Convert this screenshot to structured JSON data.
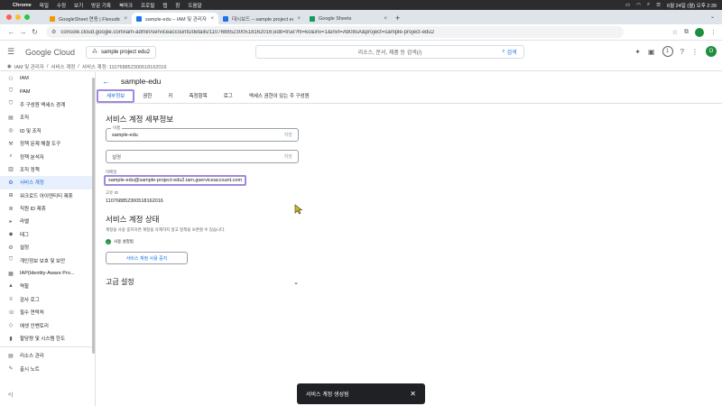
{
  "menubar": {
    "app": "Chrome",
    "items": [
      "파일",
      "수정",
      "보기",
      "방문 기록",
      "북마크",
      "프로필",
      "탭",
      "창",
      "도움말"
    ],
    "datetime": "6월 24일 (월) 오후 2:39"
  },
  "browser": {
    "tabs": [
      {
        "title": "GoogleSheet 연동 | Flexudio",
        "color": "#f29900"
      },
      {
        "title": "sample-edu – IAM 및 관리자 –",
        "color": "#1a73e8"
      },
      {
        "title": "대시보드 – sample project edu",
        "color": "#1a73e8"
      },
      {
        "title": "Google Sheets",
        "color": "#0f9d58"
      }
    ],
    "new_tab": "+",
    "url": "console.cloud.google.com/iam-admin/serviceaccounts/details/110768852300518162016;edit=true?hl=ko&inv=1&invt=Ab08sA&project=sample-project-edu2",
    "account_initial": ""
  },
  "header": {
    "logo": "Google Cloud",
    "project": "sample project edu2",
    "search_placeholder": "리소스, 문서, 제품 등 검색(/)",
    "search_button": "검색",
    "notif_count": "1",
    "account_initial": "O"
  },
  "breadcrumb": [
    "IAM 및 관리자",
    "서비스 계정",
    "서비스 계정: 110768852300518162016"
  ],
  "sidebar": {
    "items": [
      {
        "label": "IAM",
        "icon": "person-add-icon"
      },
      {
        "label": "PAM",
        "icon": "shield-icon"
      },
      {
        "label": "주 구성원 액세스 경계",
        "icon": "shield-icon"
      },
      {
        "label": "조직",
        "icon": "folder-icon"
      },
      {
        "label": "ID 및 조직",
        "icon": "fingerprint-icon"
      },
      {
        "label": "정책 문제 해결 도구",
        "icon": "wrench-icon"
      },
      {
        "label": "정책 분석자",
        "icon": "search-list-icon"
      },
      {
        "label": "조직 정책",
        "icon": "document-icon"
      },
      {
        "label": "서비스 계정",
        "icon": "service-account-icon"
      },
      {
        "label": "워크로드 아이덴티티 제휴",
        "icon": "federation-icon"
      },
      {
        "label": "직원 ID 제휴",
        "icon": "list-icon"
      },
      {
        "label": "라벨",
        "icon": "label-icon"
      },
      {
        "label": "태그",
        "icon": "tag-icon"
      },
      {
        "label": "설정",
        "icon": "gear-icon"
      },
      {
        "label": "개인정보 보호 및 보안",
        "icon": "shield-icon"
      },
      {
        "label": "IAP(Identity-Aware Pro...",
        "icon": "iap-icon"
      },
      {
        "label": "역할",
        "icon": "hat-icon"
      },
      {
        "label": "감사 로그",
        "icon": "log-icon"
      },
      {
        "label": "필수 연락처",
        "icon": "contacts-icon"
      },
      {
        "label": "애셋 인벤토리",
        "icon": "inventory-icon"
      },
      {
        "label": "할당량 및 시스템 한도",
        "icon": "quota-icon"
      },
      {
        "label": "리소스 관리",
        "icon": "resource-icon"
      },
      {
        "label": "출시 노트",
        "icon": "notes-icon"
      }
    ],
    "active_index": 8,
    "collapse_label": "<|"
  },
  "page": {
    "back_label": "←",
    "title": "sample-edu",
    "tabs": [
      "세부정보",
      "권한",
      "키",
      "측정항목",
      "로그",
      "액세스 권한이 있는 주 구성원"
    ],
    "active_tab": 0,
    "details_title": "서비스 계정 세부정보",
    "name_label": "이름",
    "name_value": "sample-edu",
    "save_hint": "저장",
    "desc_placeholder": "설명",
    "save_hint2": "저장",
    "email_label": "이메일",
    "email": "sample-edu@sample-project-edu2.iam.gserviceaccount.com",
    "unique_id_label": "고유 ID",
    "unique_id": "110768852300518162016",
    "status_title": "서비스 계정 상태",
    "status_desc": "계정을 사용 중지하면 계정을 삭제하지 않고 정책을 보존할 수 있습니다.",
    "status_value": "사용 설정됨",
    "disable_button": "서비스 계정 사용 중지",
    "advanced_title": "고급 설정"
  },
  "snackbar": {
    "message": "서비스 계정 생성됨",
    "close": "✕"
  }
}
